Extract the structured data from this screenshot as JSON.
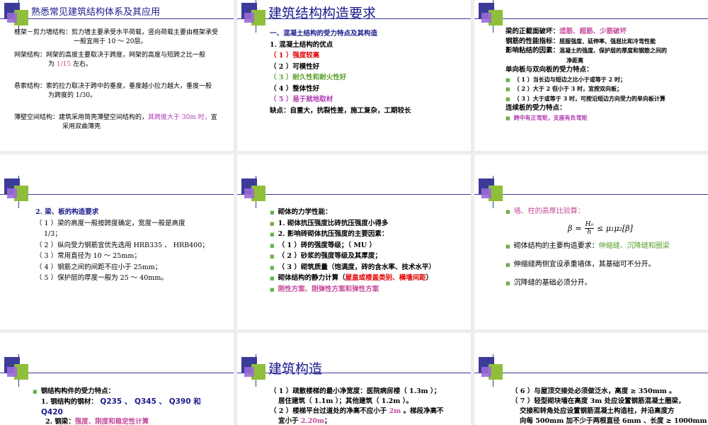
{
  "s1": {
    "title": "熟悉常见建筑结构体系及其应用",
    "l1a": "框架－剪力墙结构：剪力墙主要承受水平荷载，竖向荷载主要由框架承受",
    "l1b": "一般宜用于 10 ～ 20层。",
    "l2a": "网架结构：网架的高度主要取决于跨度，网架的高度与短跨之比一般",
    "l2b_pre": "为 ",
    "l2b_val": "1/15",
    "l2b_post": " 左右。",
    "l3a": "悬索结构：索的拉力取决于跨中的垂度，垂度越小拉力越大，垂度一般",
    "l3b": "为跨度的 1/30。",
    "l4a_pre": "薄壁空间结构：建筑采用简壳薄壁空间结构的，",
    "l4a_hl": "其跨度大于 30m 时，",
    "l4a_post": "宜",
    "l4b": "采用双曲薄壳"
  },
  "s2": {
    "title": "建筑结构构造要求",
    "h1": "一、混凝土结构的受力特点及其构造",
    "h2": "1. 混凝土结构的优点",
    "i1": "（ 1 ）强度较高",
    "i2": "（ 2 ）可模性好",
    "i3": "（ 3 ）耐久性和耐火性好",
    "i4": "（ 4 ）整体性好",
    "i5": "（ 5 ）易于就地取材",
    "i6": "缺点：自重大，抗裂性差，施工复杂，工期较长"
  },
  "s3": {
    "l1_pre": "梁的正截面破坏：",
    "l1_hl": "适筋、超筋、少筋破坏",
    "l2_pre": "钢筋的性能指标：",
    "l2_val": "屈服强度、延伸率、强屈比和冷弯性能",
    "l3_pre": "影响粘结的因素：",
    "l3_val": "混凝土的强度、保护层的厚度和钢筋之间的",
    "l3_val2": "净距离",
    "l4": "单向板与双向板的受力特点：",
    "b1": "（ 1 ）当长边与短边之比小于或等于 2 时；",
    "b2": "（ 2 ）大于 2 但小于 3 时，宜按双向板；",
    "b3": "（ 3 ）大于或等于 3 时，可按沿短边方向受力的单向板计算",
    "l5": "连续板的受力特点：",
    "b4": "跨中有正弯矩，支座有负弯矩"
  },
  "s4": {
    "h1": "2. 梁、板的构造要求",
    "i1a": "（ 1 ）梁的高度一般按跨度确定，宽度一般是高度",
    "i1b": "1/3；",
    "i2": "（ 2 ）纵向受力钢筋宜优先选用 HRB335 、 HRB400；",
    "i3": "（ 3 ）常用直径为 10 ～ 25mm；",
    "i4": "（ 4 ）钢筋之间的间距不应小于 25mm；",
    "i5": "（ 5 ）保护层的厚度一般为 25 ～ 40mm。"
  },
  "s5": {
    "b1": "砌体的力学性能：",
    "b2": "1. 砌体抗压强度比砖抗压强度小得多",
    "b3": "2. 影响砖砌体抗压强度的主要因素：",
    "b4": "（ 1 ）砖的强度等级；（ MU ）",
    "b5": "（ 2 ）砂浆的强度等级及其厚度；",
    "b6": "（ 3 ）砌筑质量（饱满度，砖的含水率、技术水平）",
    "b7_pre": "砌体结构的静力计算（",
    "b7_hl": "屋盖或楼盖类别、横墙间距",
    "b7_post": "）",
    "b8": "刚性方案、刚弹性方案和弹性方案"
  },
  "s6": {
    "b1": "墙、柱的高厚比验算：",
    "formula": "β = H₀ / h ≤ μ₁μ₂[β]",
    "f_beta": "β",
    "f_h0": "H₀",
    "f_h": "h",
    "f_rhs": "≤ μ₁μ₂[β]",
    "b2_pre": "砌体结构的主要构造要求：",
    "b2_hl": "伸缩缝、沉降缝和圈梁",
    "b3": "伸缩缝两侧宜设承重墙体，其基础可不分开。",
    "b4": "沉降缝的基础必须分开。"
  },
  "s7": {
    "b1": "钢结构构件的受力特点：",
    "l1_pre": "1. 钢结构的钢材：",
    "l1_hl": " Q235 、 Q345 、 Q390 和",
    "l1_hl2": "Q420",
    "l2_pre": "2. 钢梁：",
    "l2_hl": "强度、刚度和稳定性计算"
  },
  "s8": {
    "title": "建筑构造",
    "l1": "（ 1 ）疏散楼梯的最小净宽度：医院病房楼（ 1.3m ）；",
    "l2": "居住建筑（ 1.1m ）；其他建筑（ 1.2m ）。",
    "l3_pre": "（ 2 ）楼梯平台过道处的净高不应小于 ",
    "l3_hl": "2m",
    "l3_post": " 。梯段净高不",
    "l4_pre": "宜小于 ",
    "l4_hl": "2.20m",
    "l4_post": "；"
  },
  "s9": {
    "l1": "（ 6 ）与屋顶交接处必须做泛水，高度 ≥ 350mm 。",
    "l2": "（ 7 ）轻型砌块墙在高度 3m 处应设置钢筋混凝土圈梁，",
    "l3": "交接和转角处应设置钢筋混凝土构造柱，并沿高度方",
    "l4": "向每 500mm 加不少于两根直径 6mm 、长度 ≥ 1000mm 钢"
  }
}
